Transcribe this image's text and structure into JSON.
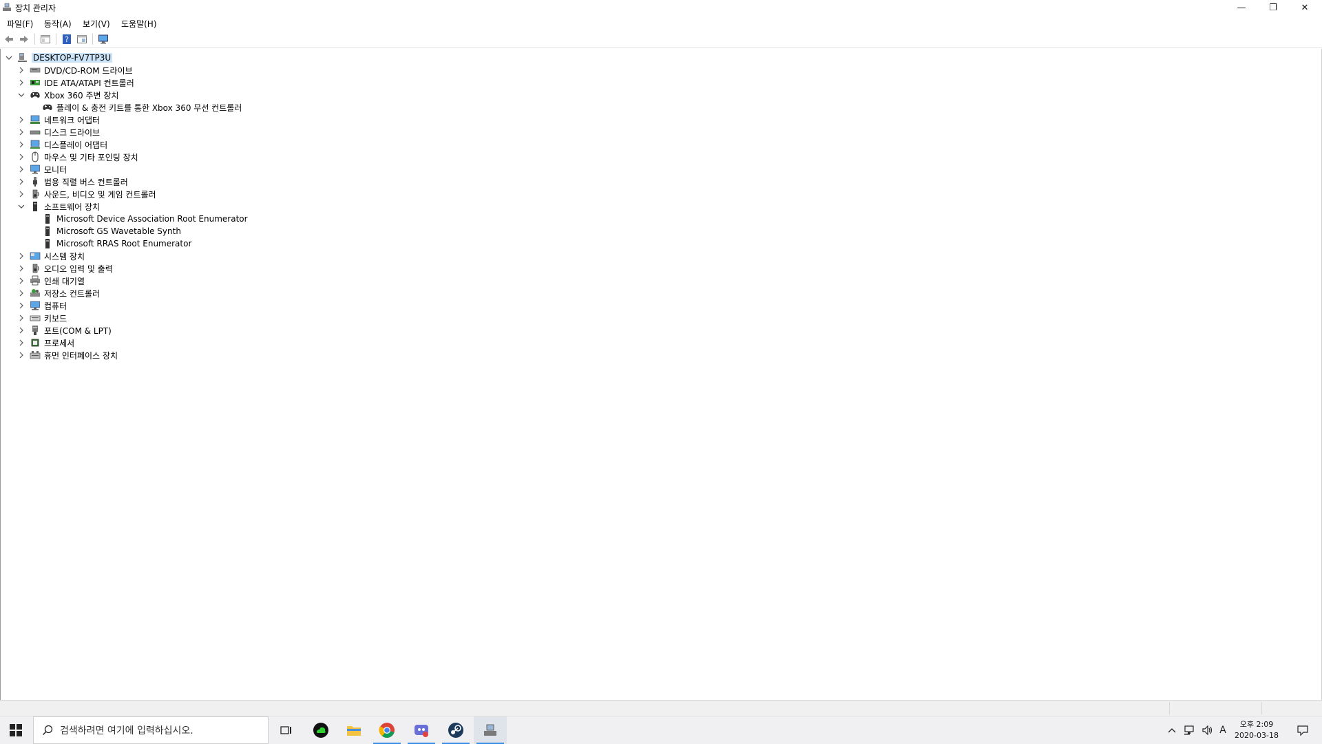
{
  "window": {
    "title": "장치 관리자",
    "controls": {
      "minimize": "—",
      "restore": "❐",
      "close": "✕"
    }
  },
  "menu": [
    "파일(F)",
    "동작(A)",
    "보기(V)",
    "도움말(H)"
  ],
  "toolbar": {
    "icons": [
      "back-arrow-icon",
      "forward-arrow-icon",
      "properties-window-icon",
      "help-icon",
      "view-window-icon",
      "monitor-icon"
    ]
  },
  "tree": {
    "root": "DESKTOP-FV7TP3U",
    "items": [
      {
        "label": "DVD/CD-ROM 드라이브",
        "icon": "dvd-drive-icon",
        "expanded": false
      },
      {
        "label": "IDE ATA/ATAPI 컨트롤러",
        "icon": "ide-controller-icon",
        "expanded": false
      },
      {
        "label": "Xbox 360 주변 장치",
        "icon": "gamepad-icon",
        "expanded": true
      },
      {
        "label": "플레이 & 충전 키트를 통한 Xbox 360 무선 컨트롤러",
        "icon": "gamepad-icon",
        "child": true
      },
      {
        "label": "네트워크 어댑터",
        "icon": "network-adapter-icon",
        "expanded": false
      },
      {
        "label": "디스크 드라이브",
        "icon": "disk-drive-icon",
        "expanded": false
      },
      {
        "label": "디스플레이 어댑터",
        "icon": "display-adapter-icon",
        "expanded": false
      },
      {
        "label": "마우스 및 기타 포인팅 장치",
        "icon": "mouse-icon",
        "expanded": false
      },
      {
        "label": "모니터",
        "icon": "monitor-icon",
        "expanded": false
      },
      {
        "label": "범용 직렬 버스 컨트롤러",
        "icon": "usb-icon",
        "expanded": false
      },
      {
        "label": "사운드, 비디오 및 게임 컨트롤러",
        "icon": "speaker-icon",
        "expanded": false
      },
      {
        "label": "소프트웨어 장치",
        "icon": "software-device-icon",
        "expanded": true
      },
      {
        "label": "Microsoft Device Association Root Enumerator",
        "icon": "software-device-icon",
        "child": true
      },
      {
        "label": "Microsoft GS Wavetable Synth",
        "icon": "software-device-icon",
        "child": true
      },
      {
        "label": "Microsoft RRAS Root Enumerator",
        "icon": "software-device-icon",
        "child": true
      },
      {
        "label": "시스템 장치",
        "icon": "system-device-icon",
        "expanded": false
      },
      {
        "label": "오디오 입력 및 출력",
        "icon": "speaker-icon",
        "expanded": false
      },
      {
        "label": "인쇄 대기열",
        "icon": "printer-icon",
        "expanded": false
      },
      {
        "label": "저장소 컨트롤러",
        "icon": "storage-controller-icon",
        "expanded": false
      },
      {
        "label": "컴퓨터",
        "icon": "computer-icon",
        "expanded": false
      },
      {
        "label": "키보드",
        "icon": "keyboard-icon",
        "expanded": false
      },
      {
        "label": "포트(COM & LPT)",
        "icon": "port-icon",
        "expanded": false
      },
      {
        "label": "프로세서",
        "icon": "processor-icon",
        "expanded": false
      },
      {
        "label": "휴먼 인터페이스 장치",
        "icon": "hid-icon",
        "expanded": false
      }
    ]
  },
  "taskbar": {
    "search_placeholder": "검색하려면 여기에 입력하십시오.",
    "apps": [
      "task-view-icon",
      "green-cloud-app-icon",
      "file-explorer-icon",
      "chrome-icon",
      "discord-like-app-icon",
      "steam-icon",
      "device-manager-icon"
    ],
    "tray": {
      "ime": "A"
    },
    "clock": {
      "time": "오후 2:09",
      "date": "2020-03-18"
    }
  }
}
